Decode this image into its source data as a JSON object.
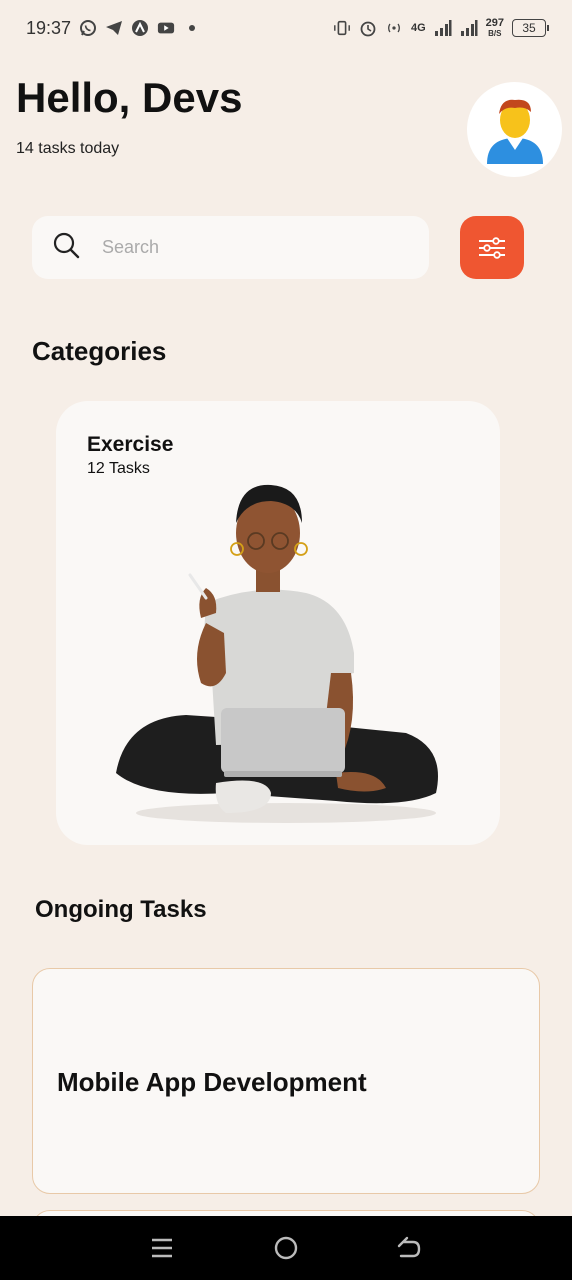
{
  "status_bar": {
    "time": "19:37",
    "left_icons": [
      "whatsapp-icon",
      "telegram-icon",
      "app-icon",
      "youtube-icon"
    ],
    "network_label": "4G",
    "speed_value": "297",
    "speed_unit": "B/S",
    "battery": "35"
  },
  "header": {
    "greeting": "Hello, Devs",
    "subtitle": "14 tasks today"
  },
  "search": {
    "placeholder": "Search"
  },
  "categories": {
    "title": "Categories",
    "items": [
      {
        "name": "Exercise",
        "count": "12 Tasks"
      }
    ]
  },
  "ongoing": {
    "title": "Ongoing Tasks",
    "items": [
      {
        "title": "Mobile App Development"
      }
    ]
  },
  "colors": {
    "background": "#f6eee7",
    "accent": "#ef5631",
    "card": "#faf8f6",
    "card_border": "#e8c9a8"
  }
}
